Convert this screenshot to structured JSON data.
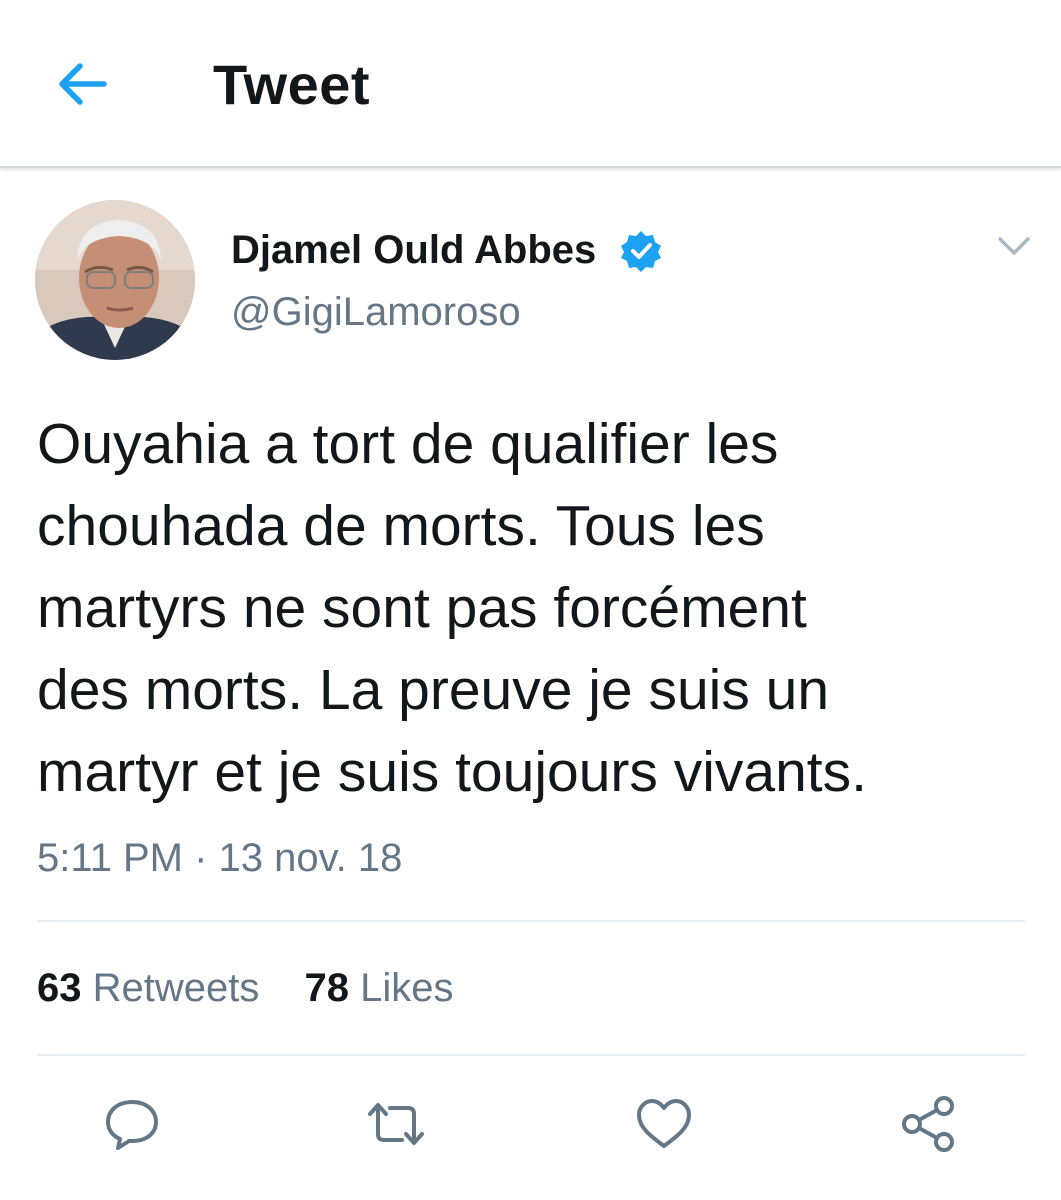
{
  "header": {
    "title": "Tweet",
    "back_icon": "arrow-left-icon",
    "accent_color": "#1da1f2"
  },
  "tweet": {
    "author": {
      "display_name": "Djamel Ould Abbes",
      "handle": "@GigiLamoroso",
      "verified": true,
      "verified_icon": "verified-badge-icon"
    },
    "text_lines": [
      "Ouyahia a tort de qualifier les",
      "chouhada de morts. Tous les",
      "martyrs ne sont pas forcément",
      "des morts. La preuve je suis un",
      "martyr et je suis toujours vivants."
    ],
    "timestamp": "5:11 PM · 13 nov. 18",
    "stats": {
      "retweets_count": "63",
      "retweets_label": "Retweets",
      "likes_count": "78",
      "likes_label": "Likes"
    },
    "actions": [
      "reply-icon",
      "retweet-icon",
      "like-icon",
      "share-icon"
    ]
  },
  "colors": {
    "text_primary": "#14171a",
    "text_secondary": "#657786",
    "divider": "#e6ecf0",
    "verified_blue": "#1da1f2"
  }
}
